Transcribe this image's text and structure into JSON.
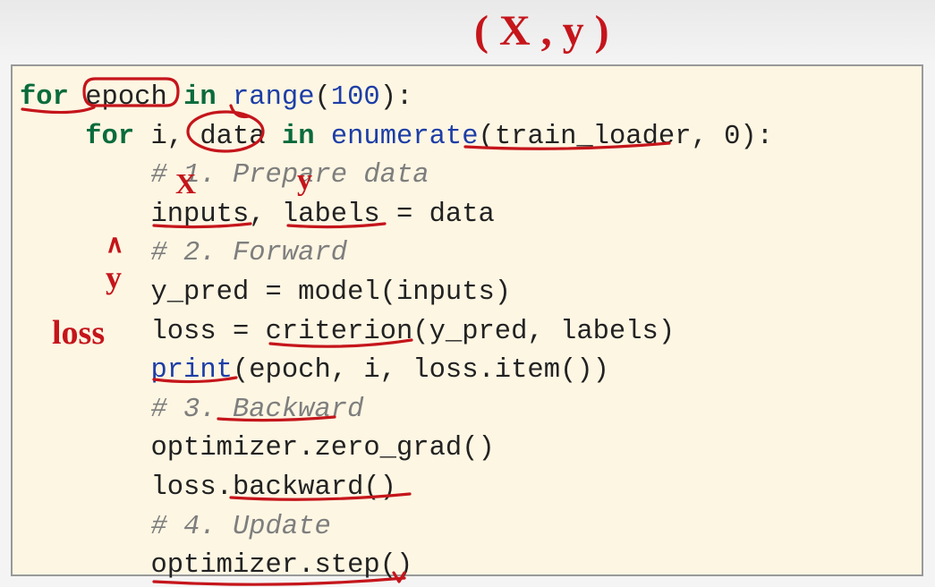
{
  "annotations": {
    "top_handwriting": "( X , y )",
    "hand_x": "X",
    "hand_y": "y",
    "hand_yhat_top": "∧",
    "hand_yhat_mid": "y",
    "hand_loss": "loss"
  },
  "code": {
    "line1": {
      "for": "for",
      "epoch": "epoch",
      "in": "in",
      "range": "range",
      "open": "(",
      "num": "100",
      "close": "):"
    },
    "line2": {
      "indent": "    ",
      "for": "for",
      "i": "i, ",
      "data": "data",
      "in": " in ",
      "enumerate": "enumerate",
      "open": "(",
      "tl": "train_loader",
      "rest": ", 0):"
    },
    "line3": {
      "indent": "        ",
      "cmt": "# 1. Prepare data"
    },
    "line4": {
      "indent": "        ",
      "text": "inputs, labels = data"
    },
    "line5": {
      "indent": "        ",
      "cmt": "# 2. Forward"
    },
    "line6": {
      "indent": "        ",
      "text": "y_pred = model(inputs)"
    },
    "line7": {
      "indent": "        ",
      "pre": "loss = ",
      "crit": "criterion",
      "post": "(y_pred, labels)"
    },
    "line8": {
      "indent": "        ",
      "print": "print",
      "post": "(epoch, i, loss.item())"
    },
    "line9": {
      "indent": "        ",
      "cmt": "# 3. Backward"
    },
    "line10": {
      "indent": "        ",
      "text": "optimizer.zero_grad()"
    },
    "line11": {
      "indent": "        ",
      "text": "loss.backward()"
    },
    "line12": {
      "indent": "        ",
      "cmt": "# 4. Update"
    },
    "line13": {
      "indent": "        ",
      "text": "optimizer.step()"
    }
  }
}
